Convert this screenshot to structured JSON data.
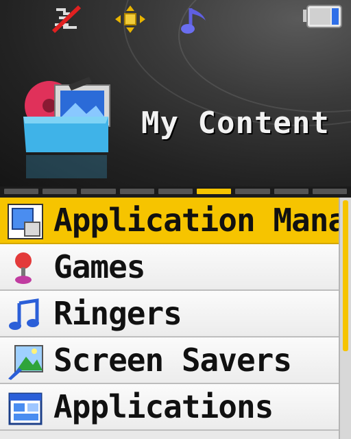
{
  "status_bar": {
    "icons": [
      "no-signal-icon",
      "navigation-icon",
      "music-note-icon",
      "battery-icon"
    ]
  },
  "header": {
    "title": "My Content",
    "icon": "folder-media-icon"
  },
  "tabs": {
    "count": 9,
    "active_index": 5
  },
  "menu": {
    "items": [
      {
        "label": "Application Manag",
        "icon": "app-manager-icon",
        "selected": true
      },
      {
        "label": "Games",
        "icon": "joystick-icon",
        "selected": false
      },
      {
        "label": "Ringers",
        "icon": "music-notes-icon",
        "selected": false
      },
      {
        "label": "Screen Savers",
        "icon": "landscape-picture-icon",
        "selected": false
      },
      {
        "label": "Applications",
        "icon": "applications-window-icon",
        "selected": false
      }
    ]
  },
  "colors": {
    "accent": "#f6c400",
    "background": "#1a1a1a",
    "row": "#f4f4f4"
  }
}
